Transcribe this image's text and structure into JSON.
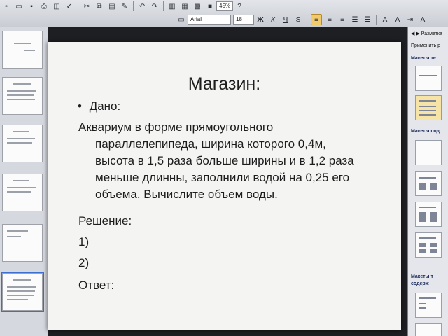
{
  "toolbar": {
    "font_name": "Arial",
    "font_size": "18",
    "zoom": "45%"
  },
  "slide": {
    "title": "Магазин:",
    "bullet_char": "•",
    "given_label": "Дано:",
    "problem_text": "Аквариум в форме прямоугольного параллелепипеда, ширина которого 0,4м, высота в 1,5 раза больше ширины и в 1,2 раза меньше длинны, заполнили  водой на 0,25 его объема. Вычислите объем воды.",
    "solution_label": "Решение:",
    "step1": "1)",
    "step2": "2)",
    "answer_label": "Ответ:"
  },
  "task_pane": {
    "header": "Разметка",
    "apply_label": "Применить р",
    "section1": "Макеты те",
    "section2": "Макеты сод",
    "section3": "Макеты т",
    "section3b": "содерж"
  }
}
